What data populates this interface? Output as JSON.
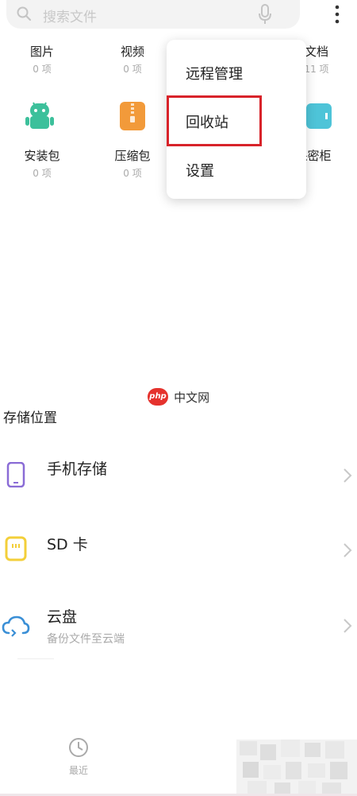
{
  "search": {
    "placeholder": "搜索文件"
  },
  "categories": [
    {
      "label": "图片",
      "count": "0 项"
    },
    {
      "label": "视频",
      "count": "0 项"
    },
    {
      "label": "文档",
      "count": "11 项"
    },
    {
      "label": "安装包",
      "count": "0 项"
    },
    {
      "label": "压缩包",
      "count": "0 项"
    },
    {
      "label": "保密柜",
      "count": ""
    }
  ],
  "menu": {
    "items": [
      {
        "label": "远程管理"
      },
      {
        "label": "回收站"
      },
      {
        "label": "设置"
      }
    ]
  },
  "watermark": {
    "logo": "php",
    "text": "中文网"
  },
  "storage": {
    "title": "存储位置",
    "items": [
      {
        "label": "手机存储",
        "sub": ""
      },
      {
        "label": "SD 卡",
        "sub": ""
      },
      {
        "label": "云盘",
        "sub": "备份文件至云端"
      }
    ]
  },
  "bottom_nav": {
    "recent": "最近"
  },
  "colors": {
    "highlight": "#d8232a",
    "android": "#3cc09b",
    "zip": "#f29a3a",
    "safe": "#4ec4d8",
    "phone": "#8a6cd6",
    "sd": "#f3cf3a",
    "cloud": "#3a8fd6"
  }
}
